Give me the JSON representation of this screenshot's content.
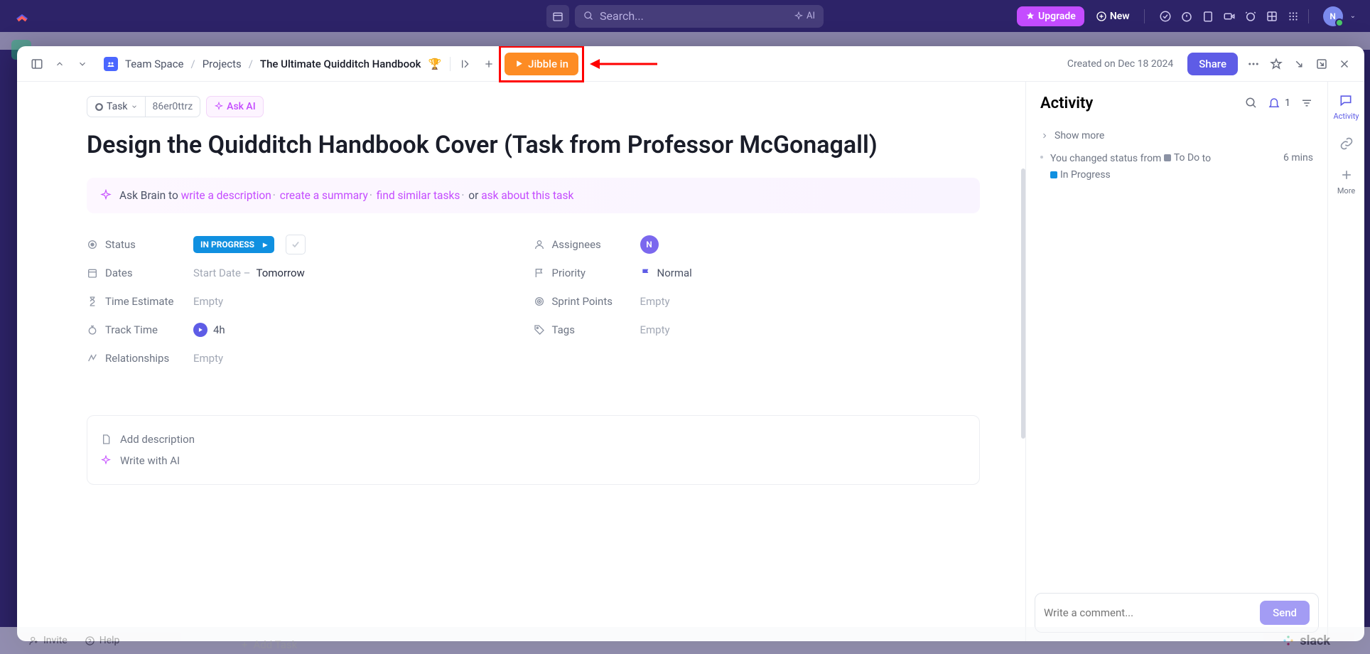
{
  "topbar": {
    "search_placeholder": "Search...",
    "ai_label": "AI",
    "upgrade_label": "Upgrade",
    "new_label": "New",
    "avatar_letter": "N"
  },
  "header": {
    "breadcrumb": {
      "space": "Team Space",
      "projects": "Projects",
      "current": "The Ultimate Quidditch Handbook",
      "emoji": "🏆"
    },
    "jibble_label": "Jibble in",
    "created_on": "Created on Dec 18 2024",
    "share_label": "Share"
  },
  "task": {
    "chip_task": "Task",
    "chip_id": "86er0ttrz",
    "ask_ai": "Ask AI",
    "title": "Design the Quidditch Handbook Cover (Task from Professor McGonagall)",
    "brain_prefix": "Ask Brain to",
    "brain_desc": "write a description",
    "brain_summary": "create a summary",
    "brain_similar": "find similar tasks",
    "brain_or": "or",
    "brain_ask": "ask about this task",
    "props": {
      "status_label": "Status",
      "status_value": "IN PROGRESS",
      "dates_label": "Dates",
      "start_date": "Start Date –",
      "tomorrow": "Tomorrow",
      "time_estimate_label": "Time Estimate",
      "time_estimate_value": "Empty",
      "track_time_label": "Track Time",
      "track_time_value": "4h",
      "relationships_label": "Relationships",
      "relationships_value": "Empty",
      "assignees_label": "Assignees",
      "assignee_letter": "N",
      "priority_label": "Priority",
      "priority_value": "Normal",
      "sprint_label": "Sprint Points",
      "sprint_value": "Empty",
      "tags_label": "Tags",
      "tags_value": "Empty"
    },
    "add_description": "Add description",
    "write_with_ai": "Write with AI"
  },
  "activity": {
    "title": "Activity",
    "badge": "1",
    "show_more": "Show more",
    "item_prefix": "You changed status from",
    "from_status": "To Do",
    "to_word": "to",
    "to_status": "In Progress",
    "time": "6 mins",
    "comment_placeholder": "Write a comment...",
    "send_label": "Send"
  },
  "rail": {
    "activity": "Activity",
    "more": "More"
  },
  "bottom": {
    "invite": "Invite",
    "help": "Help",
    "add_task": "Add Task",
    "slack": "slack"
  }
}
